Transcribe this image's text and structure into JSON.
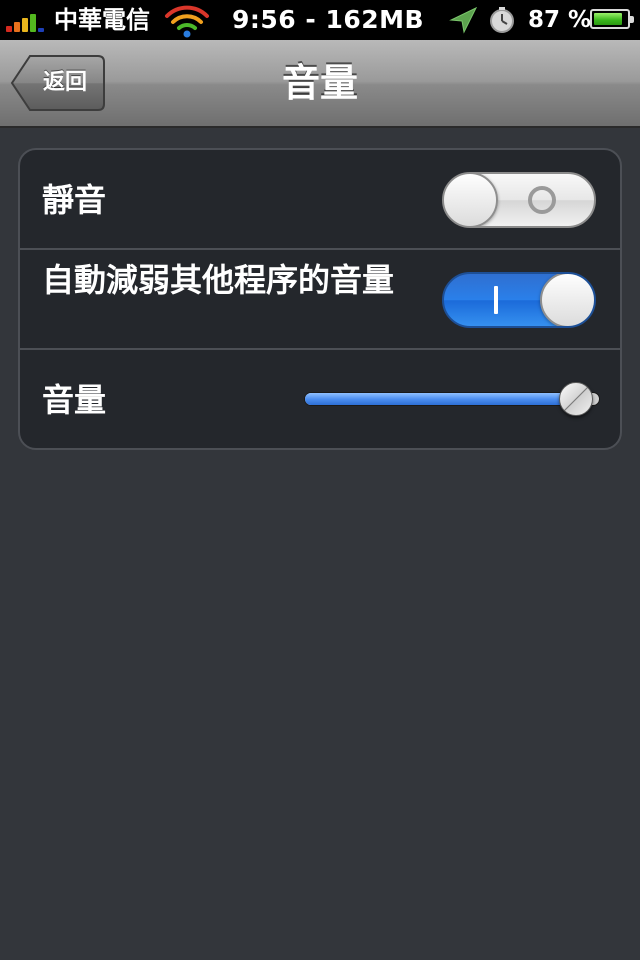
{
  "status_bar": {
    "carrier": "中華電信",
    "time_memory": "9:56 - 162MB",
    "battery_percent": "87 %",
    "battery_level": 0.87,
    "icons": [
      "signal-icon",
      "wifi-icon",
      "location-icon",
      "alarm-icon",
      "battery-icon"
    ]
  },
  "nav": {
    "title": "音量",
    "back_label": "返回"
  },
  "settings": {
    "mute": {
      "label": "靜音",
      "on": false
    },
    "auto_reduce": {
      "label": "自動減弱其他程序的音量",
      "on": true
    },
    "volume": {
      "label": "音量",
      "level": 0.92
    }
  },
  "colors": {
    "background": "#33363b",
    "group_background": "#24272c",
    "toggle_on": "#2a80ea",
    "slider_fill": "#4d8ff0"
  }
}
